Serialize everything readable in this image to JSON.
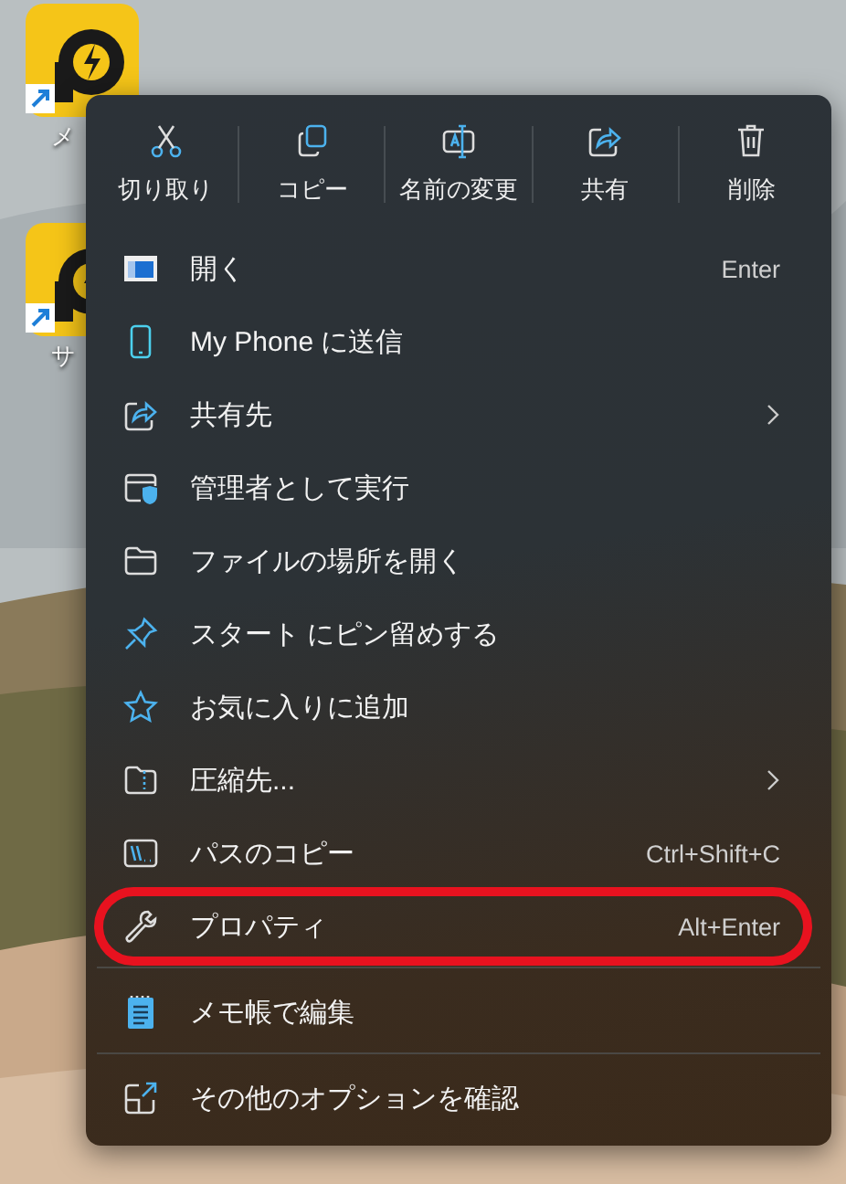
{
  "desktop_icons": [
    {
      "label": "メ"
    },
    {
      "label": "サ"
    }
  ],
  "toolbar": [
    {
      "label": "切り取り"
    },
    {
      "label": "コピー"
    },
    {
      "label": "名前の変更"
    },
    {
      "label": "共有"
    },
    {
      "label": "削除"
    }
  ],
  "sections": [
    [
      {
        "label": "開く",
        "shortcut": "Enter",
        "submenu": false,
        "highlighted": false
      },
      {
        "label": "My Phone に送信",
        "submenu": false,
        "highlighted": false
      },
      {
        "label": "共有先",
        "submenu": true,
        "highlighted": false
      },
      {
        "label": "管理者として実行",
        "submenu": false,
        "highlighted": false
      },
      {
        "label": "ファイルの場所を開く",
        "submenu": false,
        "highlighted": false
      },
      {
        "label": "スタート にピン留めする",
        "submenu": false,
        "highlighted": false
      },
      {
        "label": "お気に入りに追加",
        "submenu": false,
        "highlighted": false
      },
      {
        "label": "圧縮先...",
        "submenu": true,
        "highlighted": false
      },
      {
        "label": "パスのコピー",
        "shortcut": "Ctrl+Shift+C",
        "submenu": false,
        "highlighted": false
      },
      {
        "label": "プロパティ",
        "shortcut": "Alt+Enter",
        "submenu": false,
        "highlighted": true
      }
    ],
    [
      {
        "label": "メモ帳で編集",
        "submenu": false,
        "highlighted": false
      }
    ],
    [
      {
        "label": "その他のオプションを確認",
        "submenu": false,
        "highlighted": false
      }
    ]
  ]
}
